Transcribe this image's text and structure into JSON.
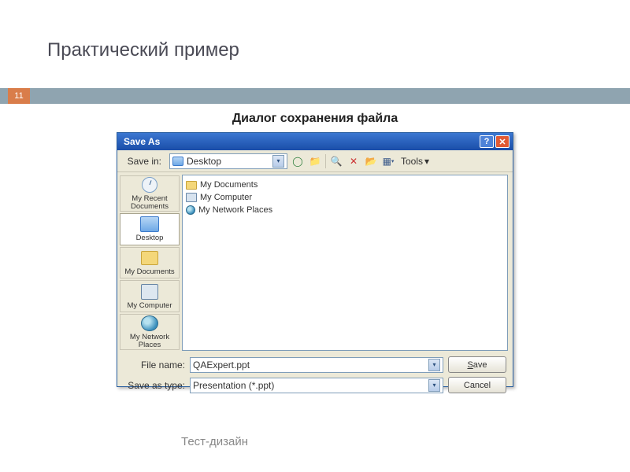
{
  "slide": {
    "title": "Практический пример",
    "number": "11",
    "subheading": "Диалог сохранения файла",
    "footer": "Тест-дизайн"
  },
  "dialog": {
    "title": "Save As",
    "help_symbol": "?",
    "close_symbol": "✕",
    "toolbar": {
      "savein_label": "Save in:",
      "savein_value": "Desktop",
      "tools_label": "Tools",
      "dropdown_arrow": "▾",
      "menu_arrow": "▾"
    },
    "places": [
      {
        "label": "My Recent Documents"
      },
      {
        "label": "Desktop"
      },
      {
        "label": "My Documents"
      },
      {
        "label": "My Computer"
      },
      {
        "label": "My Network Places"
      }
    ],
    "files": [
      {
        "name": "My Documents"
      },
      {
        "name": "My Computer"
      },
      {
        "name": "My Network Places"
      }
    ],
    "form": {
      "filename_label": "File name:",
      "filename_value": "QAExpert.ppt",
      "saveastype_label": "Save as type:",
      "saveastype_value": "Presentation (*.ppt)",
      "save_button": "Save",
      "cancel_button": "Cancel"
    }
  }
}
